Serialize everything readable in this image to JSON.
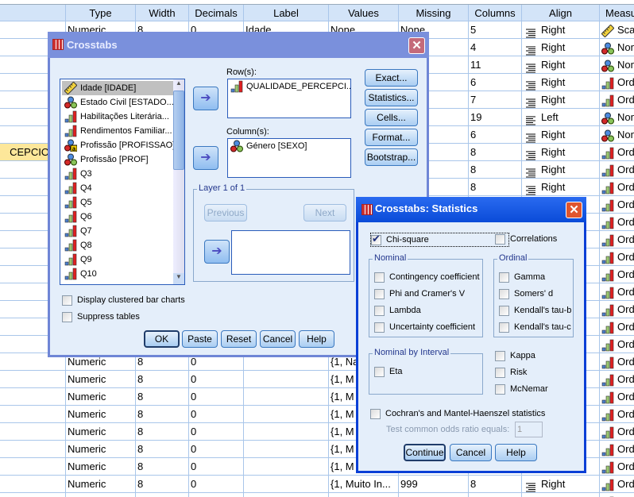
{
  "grid": {
    "columns": [
      "",
      "Type",
      "Width",
      "Decimals",
      "Label",
      "Values",
      "Missing",
      "Columns",
      "Align",
      "Measure"
    ],
    "header_visible": [
      "",
      "Type",
      "Width",
      "Decimals",
      "Label",
      "Values",
      "Missing",
      "Columns",
      "Align",
      "M"
    ],
    "rows": [
      {
        "name": "",
        "type": "Numeric",
        "width": "8",
        "decimals": "0",
        "label": "Idade",
        "values": "None",
        "missing": "None",
        "columns": "5",
        "align": "Right",
        "measure": "Scale",
        "measure_icon": "scale-ruler"
      },
      {
        "columns": "4",
        "align": "Right",
        "measure": "Nominal",
        "measure_icon": "nominal"
      },
      {
        "columns": "11",
        "align": "Right",
        "measure": "Nominal",
        "measure_icon": "nominal"
      },
      {
        "columns": "6",
        "align": "Right",
        "measure": "Ordinal",
        "measure_icon": "ordinal"
      },
      {
        "columns": "7",
        "align": "Right",
        "measure": "Ordinal",
        "measure_icon": "ordinal"
      },
      {
        "columns": "19",
        "align": "Left",
        "measure": "Nominal",
        "measure_icon": "nominal"
      },
      {
        "columns": "6",
        "align": "Right",
        "measure": "Nominal",
        "measure_icon": "nominal"
      },
      {
        "name": "CEPCIONA",
        "selected": true,
        "columns": "8",
        "align": "Right",
        "measure": "Ordinal",
        "measure_icon": "ordinal"
      },
      {
        "columns": "8",
        "align": "Right",
        "measure": "Ordinal",
        "measure_icon": "ordinal"
      },
      {
        "columns": "8",
        "align": "Right",
        "measure": "Ordinal",
        "measure_icon": "ordinal"
      },
      {
        "measure": "Ordinal",
        "measure_icon": "ordinal"
      },
      {
        "measure": "Ordinal",
        "measure_icon": "ordinal"
      },
      {
        "measure": "Ordinal",
        "measure_icon": "ordinal"
      },
      {
        "measure": "Ordinal",
        "measure_icon": "ordinal"
      },
      {
        "measure": "Ordinal",
        "measure_icon": "ordinal"
      },
      {
        "measure": "Ordinal",
        "measure_icon": "ordinal"
      },
      {
        "measure": "Ordinal",
        "measure_icon": "ordinal"
      },
      {
        "measure": "Ordinal",
        "measure_icon": "ordinal"
      },
      {
        "measure": "Ordinal",
        "measure_icon": "ordinal"
      },
      {
        "type": "Numeric",
        "width": "8",
        "decimals": "0",
        "values": "{1, Na",
        "measure": "Ordinal",
        "measure_icon": "ordinal"
      },
      {
        "type": "Numeric",
        "width": "8",
        "decimals": "0",
        "values": "{1, M",
        "measure": "Ordinal",
        "measure_icon": "ordinal"
      },
      {
        "type": "Numeric",
        "width": "8",
        "decimals": "0",
        "values": "{1, M",
        "measure": "Ordinal",
        "measure_icon": "ordinal"
      },
      {
        "type": "Numeric",
        "width": "8",
        "decimals": "0",
        "values": "{1, M",
        "measure": "Ordinal",
        "measure_icon": "ordinal"
      },
      {
        "type": "Numeric",
        "width": "8",
        "decimals": "0",
        "values": "{1, M",
        "measure": "Ordinal",
        "measure_icon": "ordinal"
      },
      {
        "type": "Numeric",
        "width": "8",
        "decimals": "0",
        "values": "{1, M",
        "measure": "Ordinal",
        "measure_icon": "ordinal"
      },
      {
        "type": "Numeric",
        "width": "8",
        "decimals": "0",
        "values": "{1, M",
        "measure": "Ordinal",
        "measure_icon": "ordinal"
      },
      {
        "type": "Numeric",
        "width": "8",
        "decimals": "0",
        "values": "{1, Muito In...",
        "missing": "999",
        "columns": "8",
        "align": "Right",
        "measure": "Ordinal",
        "measure_icon": "ordinal"
      },
      {
        "measure_icon": "ordinal"
      }
    ]
  },
  "crosstabs": {
    "title": "Crosstabs",
    "variables": [
      {
        "label": "Idade [IDADE]",
        "icon": "scale-ruler",
        "selected": true
      },
      {
        "label": "Estado Civil [ESTADO...",
        "icon": "nominal"
      },
      {
        "label": "Habilitações Literária...",
        "icon": "ordinal"
      },
      {
        "label": "Rendimentos Familiar...",
        "icon": "ordinal"
      },
      {
        "label": "Profissão [PROFISSAO]",
        "icon": "nominal-string"
      },
      {
        "label": "Profissão [PROF]",
        "icon": "nominal"
      },
      {
        "label": "Q3",
        "icon": "ordinal"
      },
      {
        "label": "Q4",
        "icon": "ordinal"
      },
      {
        "label": "Q5",
        "icon": "ordinal"
      },
      {
        "label": "Q6",
        "icon": "ordinal"
      },
      {
        "label": "Q7",
        "icon": "ordinal"
      },
      {
        "label": "Q8",
        "icon": "ordinal"
      },
      {
        "label": "Q9",
        "icon": "ordinal"
      },
      {
        "label": "Q10",
        "icon": "ordinal"
      }
    ],
    "rows_label": "Row(s):",
    "rows_value": "QUALIDADE_PERCEPCI...",
    "columns_label": "Column(s):",
    "columns_value": "Género [SEXO]",
    "layer_label": "Layer 1 of 1",
    "previous": "Previous",
    "next": "Next",
    "side_buttons": [
      "Exact...",
      "Statistics...",
      "Cells...",
      "Format...",
      "Bootstrap..."
    ],
    "display_clustered": "Display clustered bar charts",
    "suppress_tables": "Suppress tables",
    "buttons": [
      "OK",
      "Paste",
      "Reset",
      "Cancel",
      "Help"
    ]
  },
  "statistics": {
    "title": "Crosstabs: Statistics",
    "chi_square": {
      "label": "Chi-square",
      "checked": true
    },
    "correlations": {
      "label": "Correlations",
      "checked": false
    },
    "nominal_label": "Nominal",
    "nominal": [
      "Contingency coefficient",
      "Phi and Cramer's V",
      "Lambda",
      "Uncertainty coefficient"
    ],
    "ordinal_label": "Ordinal",
    "ordinal": [
      "Gamma",
      "Somers' d",
      "Kendall's tau-b",
      "Kendall's tau-c"
    ],
    "nominal_interval_label": "Nominal by Interval",
    "eta": "Eta",
    "other": [
      "Kappa",
      "Risk",
      "McNemar"
    ],
    "cochran": "Cochran's and Mantel-Haenszel statistics",
    "odds_label": "Test common odds ratio equals:",
    "odds_value": "1",
    "buttons": [
      "Continue",
      "Cancel",
      "Help"
    ]
  }
}
